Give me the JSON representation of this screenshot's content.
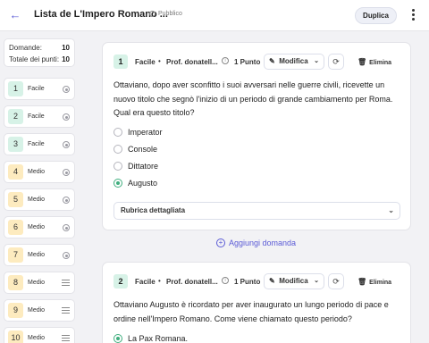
{
  "header": {
    "title": "Lista de L'Impero Romano ...",
    "visibility": "Pubblico",
    "duplicate_label": "Duplica"
  },
  "sidebar": {
    "summary": {
      "domains_label": "Domande:",
      "domains_value": "10",
      "points_label": "Totale dei punti:",
      "points_value": "10"
    },
    "items": [
      {
        "num": "1",
        "level": "Facile",
        "icon": "radio-icon",
        "color": "#d7f2e7"
      },
      {
        "num": "2",
        "level": "Facile",
        "icon": "radio-icon",
        "color": "#d7f2e7"
      },
      {
        "num": "3",
        "level": "Facile",
        "icon": "radio-icon",
        "color": "#d7f2e7"
      },
      {
        "num": "4",
        "level": "Medio",
        "icon": "radio-icon",
        "color": "#fdebbf"
      },
      {
        "num": "5",
        "level": "Medio",
        "icon": "radio-icon",
        "color": "#fdebbf"
      },
      {
        "num": "6",
        "level": "Medio",
        "icon": "radio-icon",
        "color": "#fdebbf"
      },
      {
        "num": "7",
        "level": "Medio",
        "icon": "radio-icon",
        "color": "#fdebbf"
      },
      {
        "num": "8",
        "level": "Medio",
        "icon": "lines-icon",
        "color": "#fdebbf"
      },
      {
        "num": "9",
        "level": "Medio",
        "icon": "lines-icon",
        "color": "#fdebbf"
      },
      {
        "num": "10",
        "level": "Medio",
        "icon": "lines-icon",
        "color": "#fdebbf"
      }
    ]
  },
  "questions": [
    {
      "num": "1",
      "difficulty": "Facile",
      "author": "Prof. donatell...",
      "points": "1 Punto",
      "modify_label": "Modifica",
      "delete_label": "Elimina",
      "text": "Ottaviano, dopo aver sconfitto i suoi avversari nelle guerre civili, ricevette un nuovo titolo che segnò l'inizio di un periodo di grande cambiamento per Roma. Qual era questo titolo?",
      "options": [
        {
          "label": "Imperator",
          "selected": false
        },
        {
          "label": "Console",
          "selected": false
        },
        {
          "label": "Dittatore",
          "selected": false
        },
        {
          "label": "Augusto",
          "selected": true
        }
      ],
      "rubric_label": "Rubrica dettagliata"
    },
    {
      "num": "2",
      "difficulty": "Facile",
      "author": "Prof. donatell...",
      "points": "1 Punto",
      "modify_label": "Modifica",
      "delete_label": "Elimina",
      "text": "Ottaviano Augusto è ricordato per aver inaugurato un lungo periodo di pace e ordine nell'Impero Romano. Come viene chiamato questo periodo?",
      "options": [
        {
          "label": "La Pax Romana.",
          "selected": true
        }
      ]
    }
  ],
  "add_question_label": "Aggiungi domanda",
  "colors": {
    "accent": "#5b5bd6",
    "correct": "#3fae7e"
  }
}
